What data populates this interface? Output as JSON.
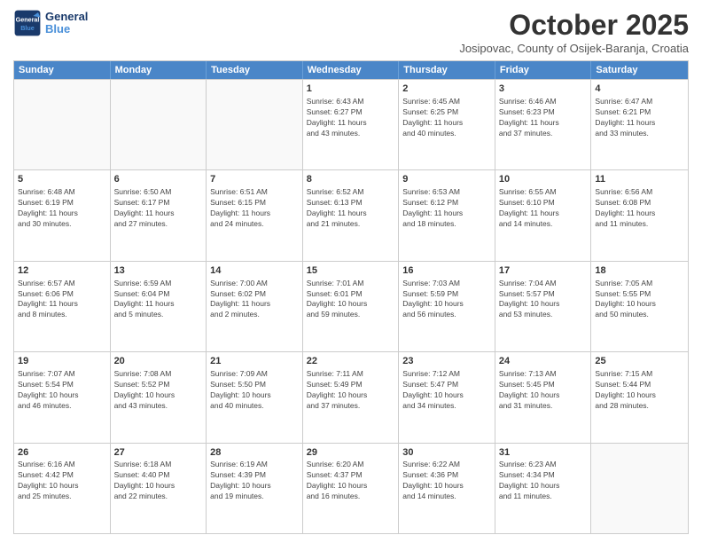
{
  "logo": {
    "line1": "General",
    "line2": "Blue"
  },
  "title": "October 2025",
  "location": "Josipovac, County of Osijek-Baranja, Croatia",
  "header_days": [
    "Sunday",
    "Monday",
    "Tuesday",
    "Wednesday",
    "Thursday",
    "Friday",
    "Saturday"
  ],
  "rows": [
    [
      {
        "day": "",
        "info": ""
      },
      {
        "day": "",
        "info": ""
      },
      {
        "day": "",
        "info": ""
      },
      {
        "day": "1",
        "info": "Sunrise: 6:43 AM\nSunset: 6:27 PM\nDaylight: 11 hours\nand 43 minutes."
      },
      {
        "day": "2",
        "info": "Sunrise: 6:45 AM\nSunset: 6:25 PM\nDaylight: 11 hours\nand 40 minutes."
      },
      {
        "day": "3",
        "info": "Sunrise: 6:46 AM\nSunset: 6:23 PM\nDaylight: 11 hours\nand 37 minutes."
      },
      {
        "day": "4",
        "info": "Sunrise: 6:47 AM\nSunset: 6:21 PM\nDaylight: 11 hours\nand 33 minutes."
      }
    ],
    [
      {
        "day": "5",
        "info": "Sunrise: 6:48 AM\nSunset: 6:19 PM\nDaylight: 11 hours\nand 30 minutes."
      },
      {
        "day": "6",
        "info": "Sunrise: 6:50 AM\nSunset: 6:17 PM\nDaylight: 11 hours\nand 27 minutes."
      },
      {
        "day": "7",
        "info": "Sunrise: 6:51 AM\nSunset: 6:15 PM\nDaylight: 11 hours\nand 24 minutes."
      },
      {
        "day": "8",
        "info": "Sunrise: 6:52 AM\nSunset: 6:13 PM\nDaylight: 11 hours\nand 21 minutes."
      },
      {
        "day": "9",
        "info": "Sunrise: 6:53 AM\nSunset: 6:12 PM\nDaylight: 11 hours\nand 18 minutes."
      },
      {
        "day": "10",
        "info": "Sunrise: 6:55 AM\nSunset: 6:10 PM\nDaylight: 11 hours\nand 14 minutes."
      },
      {
        "day": "11",
        "info": "Sunrise: 6:56 AM\nSunset: 6:08 PM\nDaylight: 11 hours\nand 11 minutes."
      }
    ],
    [
      {
        "day": "12",
        "info": "Sunrise: 6:57 AM\nSunset: 6:06 PM\nDaylight: 11 hours\nand 8 minutes."
      },
      {
        "day": "13",
        "info": "Sunrise: 6:59 AM\nSunset: 6:04 PM\nDaylight: 11 hours\nand 5 minutes."
      },
      {
        "day": "14",
        "info": "Sunrise: 7:00 AM\nSunset: 6:02 PM\nDaylight: 11 hours\nand 2 minutes."
      },
      {
        "day": "15",
        "info": "Sunrise: 7:01 AM\nSunset: 6:01 PM\nDaylight: 10 hours\nand 59 minutes."
      },
      {
        "day": "16",
        "info": "Sunrise: 7:03 AM\nSunset: 5:59 PM\nDaylight: 10 hours\nand 56 minutes."
      },
      {
        "day": "17",
        "info": "Sunrise: 7:04 AM\nSunset: 5:57 PM\nDaylight: 10 hours\nand 53 minutes."
      },
      {
        "day": "18",
        "info": "Sunrise: 7:05 AM\nSunset: 5:55 PM\nDaylight: 10 hours\nand 50 minutes."
      }
    ],
    [
      {
        "day": "19",
        "info": "Sunrise: 7:07 AM\nSunset: 5:54 PM\nDaylight: 10 hours\nand 46 minutes."
      },
      {
        "day": "20",
        "info": "Sunrise: 7:08 AM\nSunset: 5:52 PM\nDaylight: 10 hours\nand 43 minutes."
      },
      {
        "day": "21",
        "info": "Sunrise: 7:09 AM\nSunset: 5:50 PM\nDaylight: 10 hours\nand 40 minutes."
      },
      {
        "day": "22",
        "info": "Sunrise: 7:11 AM\nSunset: 5:49 PM\nDaylight: 10 hours\nand 37 minutes."
      },
      {
        "day": "23",
        "info": "Sunrise: 7:12 AM\nSunset: 5:47 PM\nDaylight: 10 hours\nand 34 minutes."
      },
      {
        "day": "24",
        "info": "Sunrise: 7:13 AM\nSunset: 5:45 PM\nDaylight: 10 hours\nand 31 minutes."
      },
      {
        "day": "25",
        "info": "Sunrise: 7:15 AM\nSunset: 5:44 PM\nDaylight: 10 hours\nand 28 minutes."
      }
    ],
    [
      {
        "day": "26",
        "info": "Sunrise: 6:16 AM\nSunset: 4:42 PM\nDaylight: 10 hours\nand 25 minutes."
      },
      {
        "day": "27",
        "info": "Sunrise: 6:18 AM\nSunset: 4:40 PM\nDaylight: 10 hours\nand 22 minutes."
      },
      {
        "day": "28",
        "info": "Sunrise: 6:19 AM\nSunset: 4:39 PM\nDaylight: 10 hours\nand 19 minutes."
      },
      {
        "day": "29",
        "info": "Sunrise: 6:20 AM\nSunset: 4:37 PM\nDaylight: 10 hours\nand 16 minutes."
      },
      {
        "day": "30",
        "info": "Sunrise: 6:22 AM\nSunset: 4:36 PM\nDaylight: 10 hours\nand 14 minutes."
      },
      {
        "day": "31",
        "info": "Sunrise: 6:23 AM\nSunset: 4:34 PM\nDaylight: 10 hours\nand 11 minutes."
      },
      {
        "day": "",
        "info": ""
      }
    ]
  ]
}
